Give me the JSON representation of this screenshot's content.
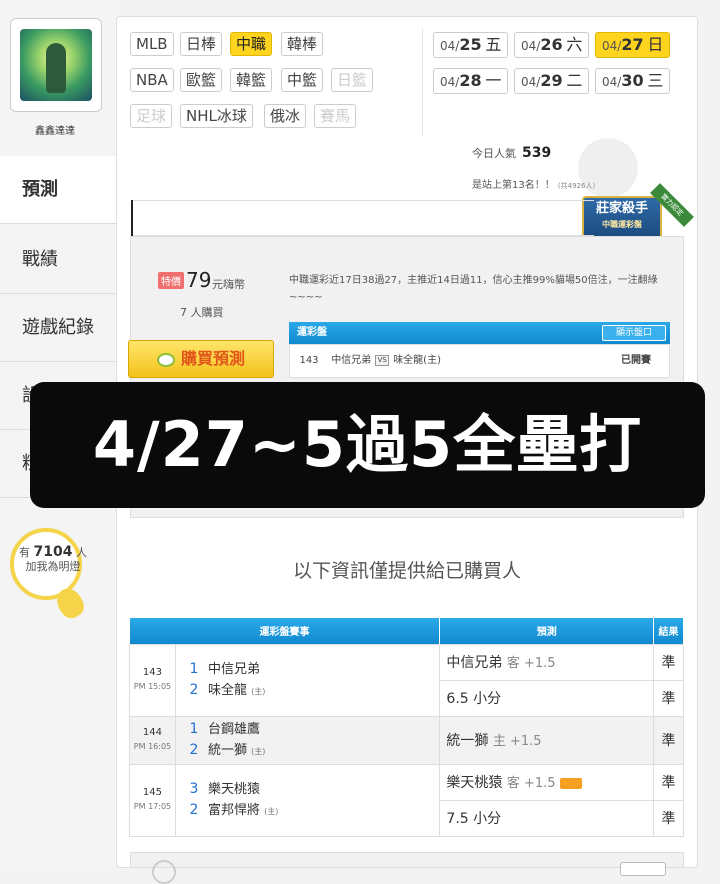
{
  "user": {
    "name": "鑫鑫達達"
  },
  "nav": [
    {
      "label": "預測",
      "active": true
    },
    {
      "label": "戰績",
      "active": false
    },
    {
      "label": "遊戲紀錄",
      "active": false
    },
    {
      "label": "設",
      "active": false
    },
    {
      "label": "粉",
      "active": false
    }
  ],
  "fans": {
    "prefix": "有",
    "count": "7104",
    "suffix": "人",
    "cta": "加我為明燈"
  },
  "leagues_row1": [
    {
      "label": "MLB",
      "state": "normal"
    },
    {
      "label": "日棒",
      "state": "normal"
    },
    {
      "label": "中職",
      "state": "active"
    },
    {
      "label": "韓棒",
      "state": "normal"
    }
  ],
  "leagues_row2": [
    {
      "label": "NBA",
      "state": "normal"
    },
    {
      "label": "歐籃",
      "state": "normal"
    },
    {
      "label": "韓籃",
      "state": "normal"
    },
    {
      "label": "中籃",
      "state": "normal"
    },
    {
      "label": "日籃",
      "state": "disabled"
    }
  ],
  "leagues_row3": [
    {
      "label": "足球",
      "state": "disabled"
    },
    {
      "label": "NHL冰球",
      "state": "normal"
    },
    {
      "label": "俄冰",
      "state": "normal"
    },
    {
      "label": "賽馬",
      "state": "disabled"
    }
  ],
  "dates": [
    {
      "md_prefix": "04/",
      "day": "25",
      "weekday": "五",
      "active": false
    },
    {
      "md_prefix": "04/",
      "day": "26",
      "weekday": "六",
      "active": false
    },
    {
      "md_prefix": "04/",
      "day": "27",
      "weekday": "日",
      "active": true
    },
    {
      "md_prefix": "04/",
      "day": "28",
      "weekday": "一",
      "active": false
    },
    {
      "md_prefix": "04/",
      "day": "29",
      "weekday": "二",
      "active": false
    },
    {
      "md_prefix": "04/",
      "day": "30",
      "weekday": "三",
      "active": false
    }
  ],
  "stats": {
    "popularity_label": "今日人氣",
    "popularity_value": "539",
    "rank_text": "是站上第13名！！",
    "rank_total": "(共4926人)"
  },
  "badge": {
    "title": "莊家殺手",
    "subtitle": "中職運彩盤",
    "ribbon": "實力認定"
  },
  "purchase": {
    "tag": "特價",
    "price": "79",
    "unit": "元嗨幣",
    "buyers": "7 人購買",
    "button": "購買預測",
    "description": "中職運彩近17日38過27，主推近14日過11，信心主推99%貓場50倍注，一注翻綠~~~~",
    "lottery_header": "運彩盤",
    "show_odds": "顯示盤口",
    "game_no": "143",
    "away_team": "中信兄弟",
    "vs": "VS",
    "home_team": "味全龍(主)",
    "status": "已開賽"
  },
  "banner": {
    "text": "4/27~5過5全壘打"
  },
  "info_note": "以下資訊僅提供給已購買人",
  "table": {
    "headers": [
      "運彩盤賽事",
      "預測",
      "結果"
    ],
    "rows": [
      {
        "no": "143",
        "time": "PM 15:05",
        "t1_idx": "1",
        "t1": "中信兄弟",
        "t2_idx": "2",
        "t2": "味全龍",
        "t2_home": "(主)",
        "preds": [
          {
            "main": "中信兄弟",
            "extra": "客 +1.5",
            "result": "準",
            "icon": false
          },
          {
            "main": "6.5 小分",
            "extra": "",
            "result": "準",
            "icon": false
          }
        ]
      },
      {
        "no": "144",
        "time": "PM 16:05",
        "t1_idx": "1",
        "t1": "台鋼雄鷹",
        "t2_idx": "2",
        "t2": "統一獅",
        "t2_home": "(主)",
        "preds": [
          {
            "main": "統一獅",
            "extra": "主 +1.5",
            "result": "準",
            "icon": false
          }
        ]
      },
      {
        "no": "145",
        "time": "PM 17:05",
        "t1_idx": "3",
        "t1": "樂天桃猿",
        "t2_idx": "2",
        "t2": "富邦悍將",
        "t2_home": "(主)",
        "preds": [
          {
            "main": "樂天桃猿",
            "extra": "客 +1.5",
            "result": "準",
            "icon": true
          },
          {
            "main": "7.5 小分",
            "extra": "",
            "result": "準",
            "icon": false
          }
        ]
      }
    ]
  }
}
